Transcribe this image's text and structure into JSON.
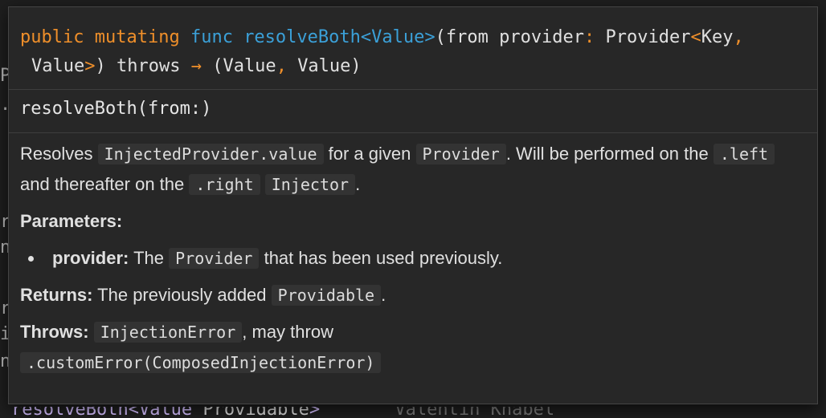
{
  "background": {
    "gutter_chars": [
      "P",
      "·",
      "r",
      "n",
      "r",
      "i",
      "n"
    ],
    "bottom_line": {
      "fn": "resolveBoth",
      "generic": "<Value",
      "type": "Providable",
      "tail": ">",
      "fade": "Valentin Knabel"
    }
  },
  "popup": {
    "signature": {
      "kw_public": "public",
      "kw_mutating": "mutating",
      "kw_func": "func",
      "fn_name": "resolveBoth",
      "generic": "<Value>",
      "params_open": "(from provider",
      "colon": ":",
      "param_type": "Provider",
      "lt": "<",
      "key": "Key",
      "comma1": ",",
      "value2": "Value",
      "gt": ">",
      "close_throws": ") throws",
      "arrow": "→",
      "ret_open": "(Value",
      "comma2": ",",
      "ret_close": "Value)"
    },
    "title": "resolveBoth(from:)",
    "description": {
      "t1": "Resolves",
      "c1": "InjectedProvider.value",
      "t2": "for a given",
      "c2": "Provider",
      "t3": ". Will be performed on the",
      "c3": ".left",
      "t4": "and thereafter on the",
      "c4": ".right",
      "c5": "Injector",
      "t5": "."
    },
    "parameters_heading": "Parameters:",
    "param": {
      "name": "provider:",
      "t1": "The",
      "code": "Provider",
      "t2": "that has been used previously."
    },
    "returns": {
      "label": "Returns:",
      "text": "The previously added",
      "code": "Providable",
      "end": "."
    },
    "throws": {
      "label": "Throws:",
      "code1": "InjectionError",
      "text": ", may throw",
      "code2": ".customError(ComposedInjectionError)"
    }
  }
}
